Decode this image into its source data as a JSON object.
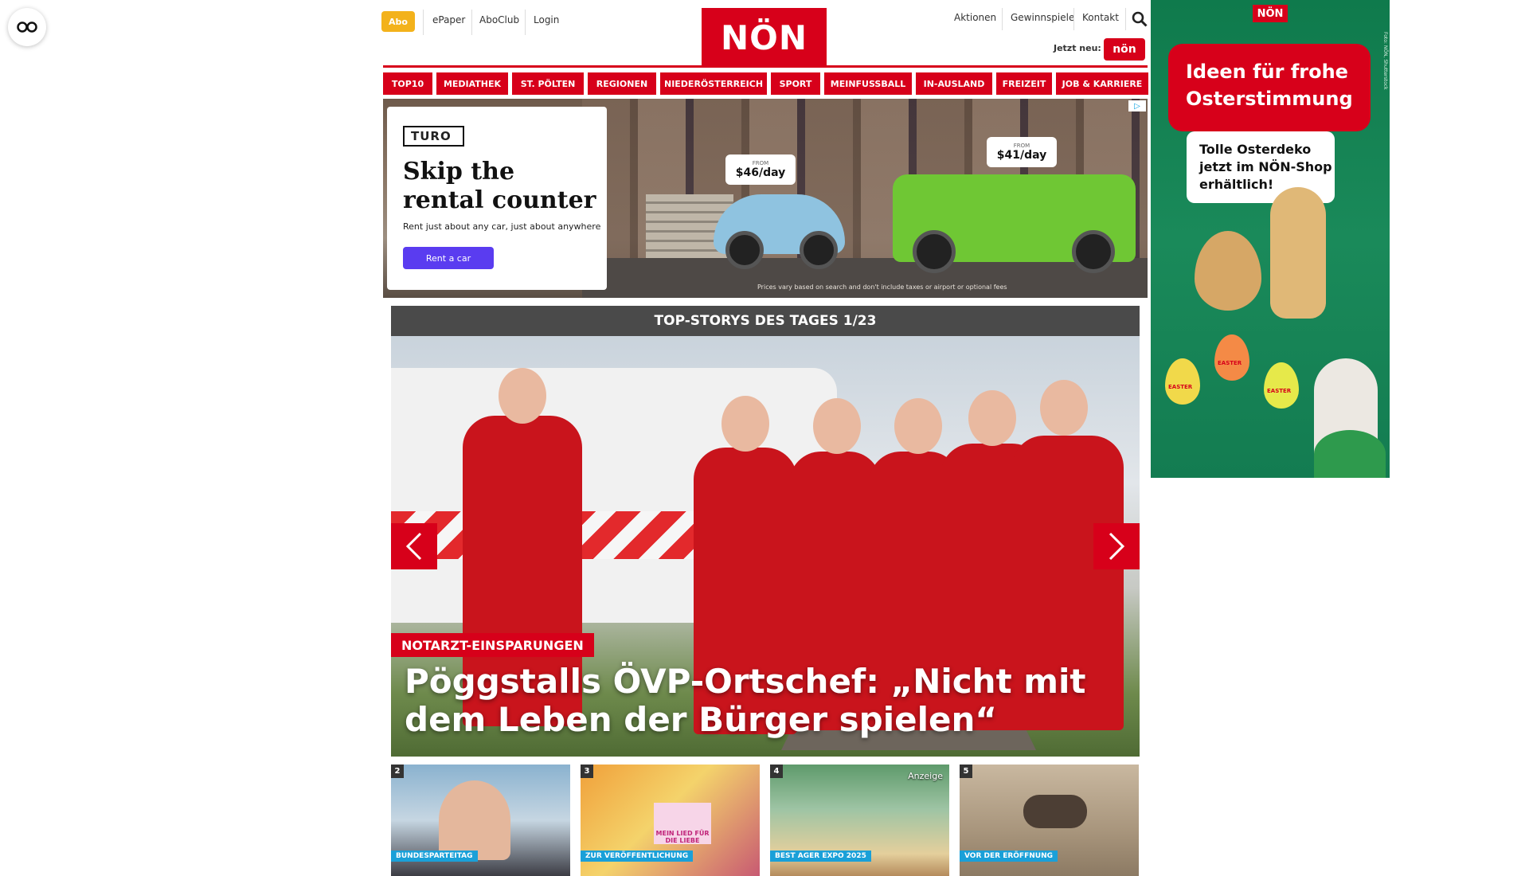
{
  "reader": {
    "icon": "reader-mode-icon"
  },
  "header": {
    "abo_label": "Abo",
    "links_left": [
      "ePaper",
      "AboClub",
      "Login"
    ],
    "logo_text": "NÖN",
    "links_right": [
      "Aktionen",
      "Gewinnspiele",
      "Kontakt"
    ],
    "jetzt_neu": "Jetzt neu:",
    "mini_logo_text": "nön",
    "search_icon": "search-icon"
  },
  "nav": [
    "TOP10",
    "MEDIATHEK",
    "ST. PÖLTEN",
    "REGIONEN",
    "NIEDERÖSTERREICH",
    "SPORT",
    "MEINFUSSBALL",
    "IN-AUSLAND",
    "FREIZEIT",
    "JOB & KARRIERE"
  ],
  "ad_banner": {
    "brand": "TURO",
    "headline": "Skip the rental counter",
    "subline": "Rent just about any car, just about anywhere",
    "cta": "Rent a car",
    "price1_from": "FROM",
    "price1": "$46/day",
    "price2_from": "FROM",
    "price2": "$41/day",
    "fine_print": "Prices vary based on search and don't include taxes or airport or optional fees"
  },
  "top_stories": {
    "bar_title": "TOP-STORYS DES TAGES 1/23",
    "kicker": "NOTARZT-EINSPARUNGEN",
    "headline": "Pöggstalls ÖVP-Ortschef: „Nicht mit dem Leben der Bürger spielen“"
  },
  "thumbs": [
    {
      "num": "2",
      "category": "BUNDESPARTEITAG"
    },
    {
      "num": "3",
      "category": "ZUR VERÖFFENTLICHUNG",
      "sign": "MEIN LIED FÜR DIE LIEBE"
    },
    {
      "num": "4",
      "category": "BEST AGER EXPO 2025",
      "badge": "Anzeige"
    },
    {
      "num": "5",
      "category": "VOR DER ERÖFFNUNG"
    }
  ],
  "side_ad": {
    "logo": "NÖN",
    "bubble_title": "Ideen für frohe Osterstimmung",
    "bubble_text": "Tolle Osterdeko jetzt im NÖN-Shop erhältlich!",
    "egg_label": "EASTER",
    "credit": "Foto: NÖN, Shutterstock"
  }
}
